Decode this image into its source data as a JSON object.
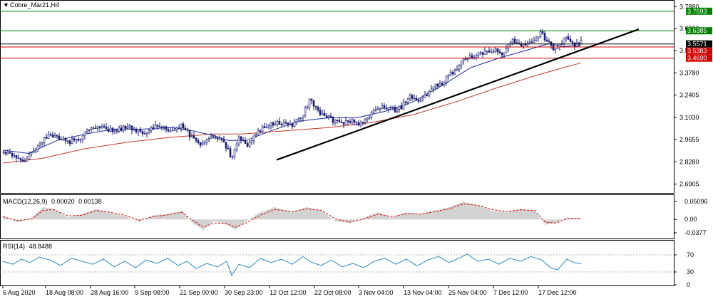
{
  "chart_data": [
    {
      "type": "candlestick",
      "title": "Cobre_Mar21,H4",
      "symbol_arrow": "▼",
      "y_ticks": [
        "3.7880",
        "3.6520",
        "3.5155",
        "3.3780",
        "3.2405",
        "3.1030",
        "2.9655",
        "2.8280",
        "2.6905"
      ],
      "ylim": [
        2.64,
        3.82
      ],
      "x_ticks": [
        "6 Aug 2020",
        "18 Aug 08:00",
        "28 Aug 16:00",
        "9 Sep 08:00",
        "21 Sep 00:00",
        "30 Sep 23:00",
        "12 Oct 12:00",
        "22 Oct 08:00",
        "3 Nov 04:00",
        "13 Nov 04:00",
        "25 Nov 04:00",
        "7 Dec 12:00",
        "17 Dec 12:00"
      ],
      "price_tags": [
        {
          "label": "3.7593",
          "value": 3.7593,
          "color": "#008000"
        },
        {
          "label": "3.6385",
          "value": 3.6385,
          "color": "#008000"
        },
        {
          "label": "3.5571",
          "value": 3.5571,
          "color": "#000000"
        },
        {
          "label": "3.5383",
          "value": 3.5383,
          "color": "#d40000"
        },
        {
          "label": "3.4690",
          "value": 3.469,
          "color": "#d40000"
        }
      ],
      "horizontal_lines": [
        {
          "value": 3.7593,
          "color": "#008000"
        },
        {
          "value": 3.6385,
          "color": "#008000"
        },
        {
          "value": 3.5571,
          "color": "#000000"
        },
        {
          "value": 3.5383,
          "color": "#d40000"
        },
        {
          "value": 3.469,
          "color": "#d40000"
        }
      ],
      "trendline": {
        "from": {
          "x": 388,
          "y": 2.84
        },
        "to": {
          "x": 896,
          "y": 3.648
        },
        "color": "#000000"
      },
      "close_path": [
        [
          4,
          2.89
        ],
        [
          20,
          2.86
        ],
        [
          35,
          2.83
        ],
        [
          52,
          2.92
        ],
        [
          68,
          3.0
        ],
        [
          80,
          2.98
        ],
        [
          95,
          2.95
        ],
        [
          110,
          2.97
        ],
        [
          125,
          3.02
        ],
        [
          140,
          3.04
        ],
        [
          160,
          3.02
        ],
        [
          180,
          3.05
        ],
        [
          200,
          3.0
        ],
        [
          220,
          3.05
        ],
        [
          240,
          3.02
        ],
        [
          255,
          3.05
        ],
        [
          265,
          3.0
        ],
        [
          280,
          2.94
        ],
        [
          295,
          2.97
        ],
        [
          312,
          2.96
        ],
        [
          320,
          2.9
        ],
        [
          325,
          2.84
        ],
        [
          335,
          2.97
        ],
        [
          348,
          2.93
        ],
        [
          362,
          3.02
        ],
        [
          375,
          3.05
        ],
        [
          390,
          3.07
        ],
        [
          410,
          3.05
        ],
        [
          425,
          3.12
        ],
        [
          435,
          3.22
        ],
        [
          445,
          3.14
        ],
        [
          460,
          3.1
        ],
        [
          475,
          3.07
        ],
        [
          490,
          3.08
        ],
        [
          505,
          3.06
        ],
        [
          520,
          3.12
        ],
        [
          535,
          3.18
        ],
        [
          550,
          3.15
        ],
        [
          562,
          3.16
        ],
        [
          575,
          3.24
        ],
        [
          590,
          3.2
        ],
        [
          605,
          3.28
        ],
        [
          620,
          3.32
        ],
        [
          635,
          3.38
        ],
        [
          650,
          3.46
        ],
        [
          665,
          3.48
        ],
        [
          680,
          3.5
        ],
        [
          695,
          3.52
        ],
        [
          705,
          3.48
        ],
        [
          718,
          3.58
        ],
        [
          730,
          3.54
        ],
        [
          745,
          3.56
        ],
        [
          758,
          3.63
        ],
        [
          768,
          3.57
        ],
        [
          778,
          3.52
        ],
        [
          788,
          3.57
        ],
        [
          798,
          3.6
        ],
        [
          806,
          3.54
        ],
        [
          815,
          3.57
        ]
      ],
      "ma_fast": [
        [
          4,
          2.9
        ],
        [
          40,
          2.88
        ],
        [
          80,
          2.96
        ],
        [
          120,
          3.0
        ],
        [
          160,
          3.03
        ],
        [
          200,
          3.03
        ],
        [
          240,
          3.04
        ],
        [
          270,
          3.02
        ],
        [
          300,
          2.99
        ],
        [
          320,
          2.96
        ],
        [
          345,
          2.96
        ],
        [
          380,
          3.02
        ],
        [
          420,
          3.08
        ],
        [
          460,
          3.1
        ],
        [
          500,
          3.1
        ],
        [
          540,
          3.14
        ],
        [
          580,
          3.2
        ],
        [
          620,
          3.3
        ],
        [
          660,
          3.41
        ],
        [
          700,
          3.47
        ],
        [
          740,
          3.52
        ],
        [
          770,
          3.56
        ],
        [
          790,
          3.54
        ],
        [
          815,
          3.55
        ]
      ],
      "ma_slow": [
        [
          4,
          2.82
        ],
        [
          60,
          2.85
        ],
        [
          120,
          2.91
        ],
        [
          180,
          2.95
        ],
        [
          240,
          2.98
        ],
        [
          300,
          3.0
        ],
        [
          340,
          3.0
        ],
        [
          400,
          3.02
        ],
        [
          460,
          3.04
        ],
        [
          520,
          3.07
        ],
        [
          580,
          3.12
        ],
        [
          640,
          3.2
        ],
        [
          700,
          3.29
        ],
        [
          750,
          3.36
        ],
        [
          790,
          3.41
        ],
        [
          815,
          3.44
        ]
      ]
    },
    {
      "type": "histogram",
      "title": "MACD(12,26,9)",
      "values_text": [
        "0.00020",
        "0.00138"
      ],
      "y_ticks": [
        "0.05096",
        "0.00",
        "-0.0377"
      ],
      "ylim": [
        -0.05,
        0.065
      ],
      "x": [
        4,
        25,
        45,
        60,
        75,
        95,
        115,
        135,
        155,
        175,
        195,
        215,
        235,
        255,
        270,
        285,
        300,
        318,
        330,
        345,
        365,
        385,
        410,
        430,
        450,
        470,
        490,
        510,
        530,
        550,
        570,
        590,
        610,
        630,
        650,
        670,
        690,
        710,
        730,
        750,
        765,
        780,
        795,
        815
      ],
      "macd": [
        0.01,
        -0.008,
        0.005,
        0.035,
        0.03,
        0.005,
        0.015,
        0.03,
        0.018,
        0.01,
        -0.008,
        0.012,
        0.015,
        0.025,
        -0.01,
        -0.03,
        -0.005,
        -0.015,
        -0.03,
        -0.005,
        0.02,
        0.035,
        0.02,
        0.035,
        0.025,
        -0.005,
        -0.01,
        0.005,
        0.02,
        0.005,
        0.02,
        0.015,
        0.025,
        0.035,
        0.05,
        0.04,
        0.025,
        0.02,
        0.03,
        0.025,
        -0.015,
        -0.01,
        0.005,
        0.002
      ],
      "signal": [
        0.008,
        -0.004,
        0.002,
        0.025,
        0.028,
        0.01,
        0.012,
        0.025,
        0.02,
        0.012,
        -0.002,
        0.008,
        0.013,
        0.02,
        -0.002,
        -0.022,
        -0.01,
        -0.012,
        -0.022,
        -0.01,
        0.012,
        0.028,
        0.022,
        0.03,
        0.026,
        0.002,
        -0.008,
        0.001,
        0.015,
        0.008,
        0.016,
        0.015,
        0.022,
        0.03,
        0.044,
        0.04,
        0.028,
        0.022,
        0.027,
        0.025,
        -0.008,
        -0.01,
        0.002,
        0.003
      ]
    },
    {
      "type": "line",
      "title": "RSI(14)",
      "value_text": "48.8488",
      "y_ticks": [
        "70",
        "30",
        "0"
      ],
      "ylim": [
        0,
        100
      ],
      "levels": [
        30,
        70
      ],
      "x": [
        4,
        18,
        30,
        42,
        55,
        70,
        85,
        100,
        115,
        130,
        145,
        160,
        175,
        190,
        205,
        220,
        235,
        250,
        262,
        275,
        290,
        305,
        318,
        325,
        335,
        350,
        365,
        380,
        395,
        410,
        425,
        435,
        450,
        465,
        480,
        495,
        510,
        525,
        540,
        555,
        570,
        585,
        600,
        615,
        630,
        645,
        655,
        670,
        685,
        700,
        715,
        730,
        745,
        760,
        772,
        782,
        795,
        805,
        815
      ],
      "values": [
        55,
        48,
        60,
        52,
        65,
        58,
        45,
        62,
        55,
        48,
        60,
        42,
        55,
        40,
        58,
        50,
        62,
        45,
        55,
        38,
        50,
        42,
        55,
        22,
        48,
        40,
        62,
        52,
        60,
        48,
        66,
        54,
        45,
        58,
        42,
        50,
        40,
        55,
        62,
        48,
        60,
        44,
        58,
        66,
        52,
        63,
        72,
        55,
        60,
        48,
        62,
        55,
        66,
        58,
        40,
        35,
        60,
        52,
        49
      ]
    }
  ]
}
